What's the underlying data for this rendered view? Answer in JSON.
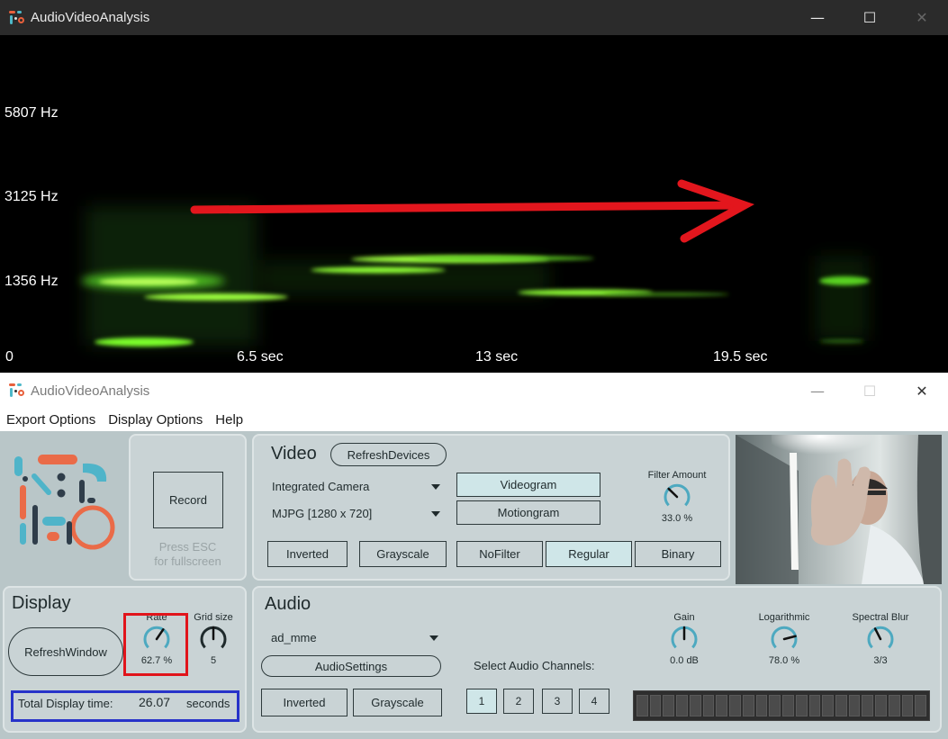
{
  "top_window": {
    "title": "AudioVideoAnalysis",
    "controls": {
      "minimize": "—",
      "maximize": "☐",
      "close": "✕"
    },
    "y_labels": [
      "5807 Hz",
      "3125 Hz",
      "1356 Hz"
    ],
    "x_labels": [
      "0",
      "6.5 sec",
      "13 sec",
      "19.5 sec"
    ],
    "arrow_color": "#e3161d",
    "spectrogram_color": "#7cff2a"
  },
  "bottom_window": {
    "title": "AudioVideoAnalysis",
    "controls": {
      "minimize": "—",
      "maximize": "☐",
      "close": "✕"
    },
    "menu": [
      "Export Options",
      "Display Options",
      "Help"
    ]
  },
  "record_panel": {
    "record_label": "Record",
    "hint_line1": "Press ESC",
    "hint_line2": "for fullscreen"
  },
  "video_panel": {
    "title": "Video",
    "refresh_label": "RefreshDevices",
    "camera_select": "Integrated Camera",
    "format_select": "MJPG [1280 x 720]",
    "videogram_label": "Videogram",
    "motiongram_label": "Motiongram",
    "filter_amount": {
      "title": "Filter Amount",
      "value": "33.0 %",
      "level": 0.33
    },
    "inverted_label": "Inverted",
    "grayscale_label": "Grayscale",
    "nofilter_label": "NoFilter",
    "regular_label": "Regular",
    "binary_label": "Binary"
  },
  "display_panel": {
    "title": "Display",
    "refresh_label": "RefreshWindow",
    "rate": {
      "title": "Rate",
      "value": "62.7 %",
      "level": 0.627
    },
    "grid_size": {
      "title": "Grid size",
      "value": "5",
      "level": 0.5
    },
    "total_label": "Total Display time:",
    "total_value": "26.07",
    "total_unit": "seconds"
  },
  "audio_panel": {
    "title": "Audio",
    "device_select": "ad_mme",
    "settings_label": "AudioSettings",
    "inverted_label": "Inverted",
    "grayscale_label": "Grayscale",
    "channels_label": "Select Audio Channels:",
    "channels": [
      "1",
      "2",
      "3",
      "4"
    ],
    "gain": {
      "title": "Gain",
      "value": "0.0 dB",
      "level": 0.5
    },
    "logarithmic": {
      "title": "Logarithmic",
      "value": "78.0 %",
      "level": 0.78
    },
    "spectral_blur": {
      "title": "Spectral Blur",
      "value": "3/3",
      "level": 0.4
    }
  },
  "colors": {
    "panel_bg": "#c9d3d5",
    "app_bg": "#b9c6c8",
    "accent_teal": "#4da9c0",
    "highlight_red": "#e1141b",
    "highlight_blue": "#2733c9"
  }
}
